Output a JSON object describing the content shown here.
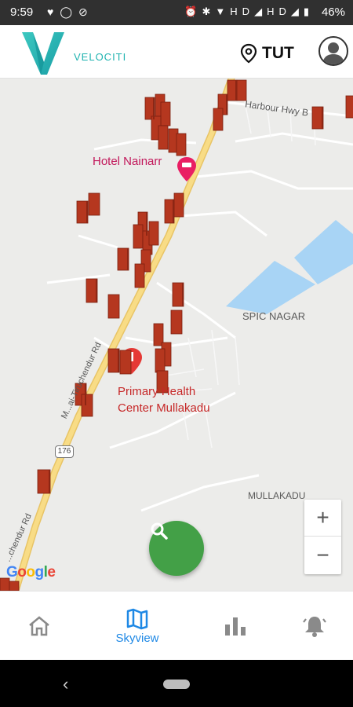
{
  "status_bar": {
    "time": "9:59",
    "left_icons": [
      "heart-icon",
      "circle-icon",
      "refresh-icon"
    ],
    "right_icons": [
      "alarm-icon",
      "bluetooth-icon",
      "wifi-icon",
      "hd-icon",
      "signal-icon",
      "hd-icon",
      "signal-icon",
      "battery-icon"
    ],
    "hd_label": "HD",
    "battery": "46%"
  },
  "header": {
    "brand": "VELOCITI",
    "location_code": "TUT",
    "brand_color": "#1fb3b0"
  },
  "map": {
    "labels": {
      "hotel": "Hotel Nainarr",
      "phc_line1": "Primary Health",
      "phc_line2": "Center Mullakadu",
      "spic": "SPIC NAGAR",
      "mullakadu": "MULLAKADU",
      "harbour_hwy": "Harbour Hwy B",
      "road_upper": "M...ai-Tiruchendur Rd",
      "road_lower": "...chendur Rd",
      "route_shield": "176"
    },
    "attribution": "Google",
    "zoom_in": "+",
    "zoom_out": "−",
    "marker_color": "#b5371f",
    "road_color": "#f6d77a",
    "water_color": "#a8d4f5"
  },
  "fab": {
    "icon": "search-icon",
    "color": "#43a047"
  },
  "bottom_nav": {
    "items": [
      {
        "icon": "home-icon",
        "label": ""
      },
      {
        "icon": "map-icon",
        "label": "Skyview",
        "active": true
      },
      {
        "icon": "bar-chart-icon",
        "label": ""
      },
      {
        "icon": "alarm-bell-icon",
        "label": ""
      }
    ],
    "active_color": "#1e88e5"
  }
}
